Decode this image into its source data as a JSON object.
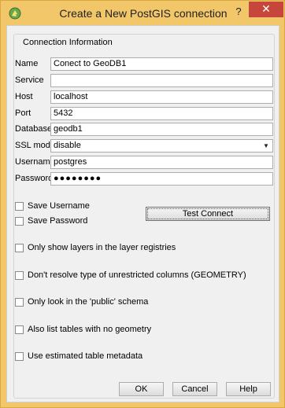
{
  "window": {
    "title": "Create a New PostGIS connection",
    "help_glyph": "?",
    "close_glyph": "✕"
  },
  "group": {
    "title": "Connection Information"
  },
  "fields": {
    "name": {
      "label": "Name",
      "value": "Conect to GeoDB1"
    },
    "service": {
      "label": "Service",
      "value": ""
    },
    "host": {
      "label": "Host",
      "value": "localhost"
    },
    "port": {
      "label": "Port",
      "value": "5432"
    },
    "database": {
      "label": "Database",
      "value": "geodb1"
    },
    "sslmode": {
      "label": "SSL mode",
      "value": "disable"
    },
    "username": {
      "label": "Username",
      "value": "postgres"
    },
    "password": {
      "label": "Password",
      "value": "●●●●●●●●"
    }
  },
  "checkboxes": {
    "save_username": {
      "label": "Save Username",
      "checked": false
    },
    "save_password": {
      "label": "Save Password",
      "checked": false
    },
    "only_registries": {
      "label": "Only show layers in the layer registries",
      "checked": false
    },
    "dont_resolve": {
      "label": "Don't resolve type of unrestricted columns (GEOMETRY)",
      "checked": false
    },
    "public_schema": {
      "label": "Only look in the 'public' schema",
      "checked": false
    },
    "no_geometry": {
      "label": "Also list tables with no geometry",
      "checked": false
    },
    "estimated_metadata": {
      "label": "Use estimated table metadata",
      "checked": false
    }
  },
  "buttons": {
    "test_connect": "Test Connect",
    "ok": "OK",
    "cancel": "Cancel",
    "help": "Help"
  },
  "icons": {
    "app": "qgis-icon",
    "dropdown": "chevron-down-icon"
  },
  "colors": {
    "titlebar": "#f2c76a",
    "close": "#c7463b",
    "dialog_bg": "#f0f0f0"
  }
}
